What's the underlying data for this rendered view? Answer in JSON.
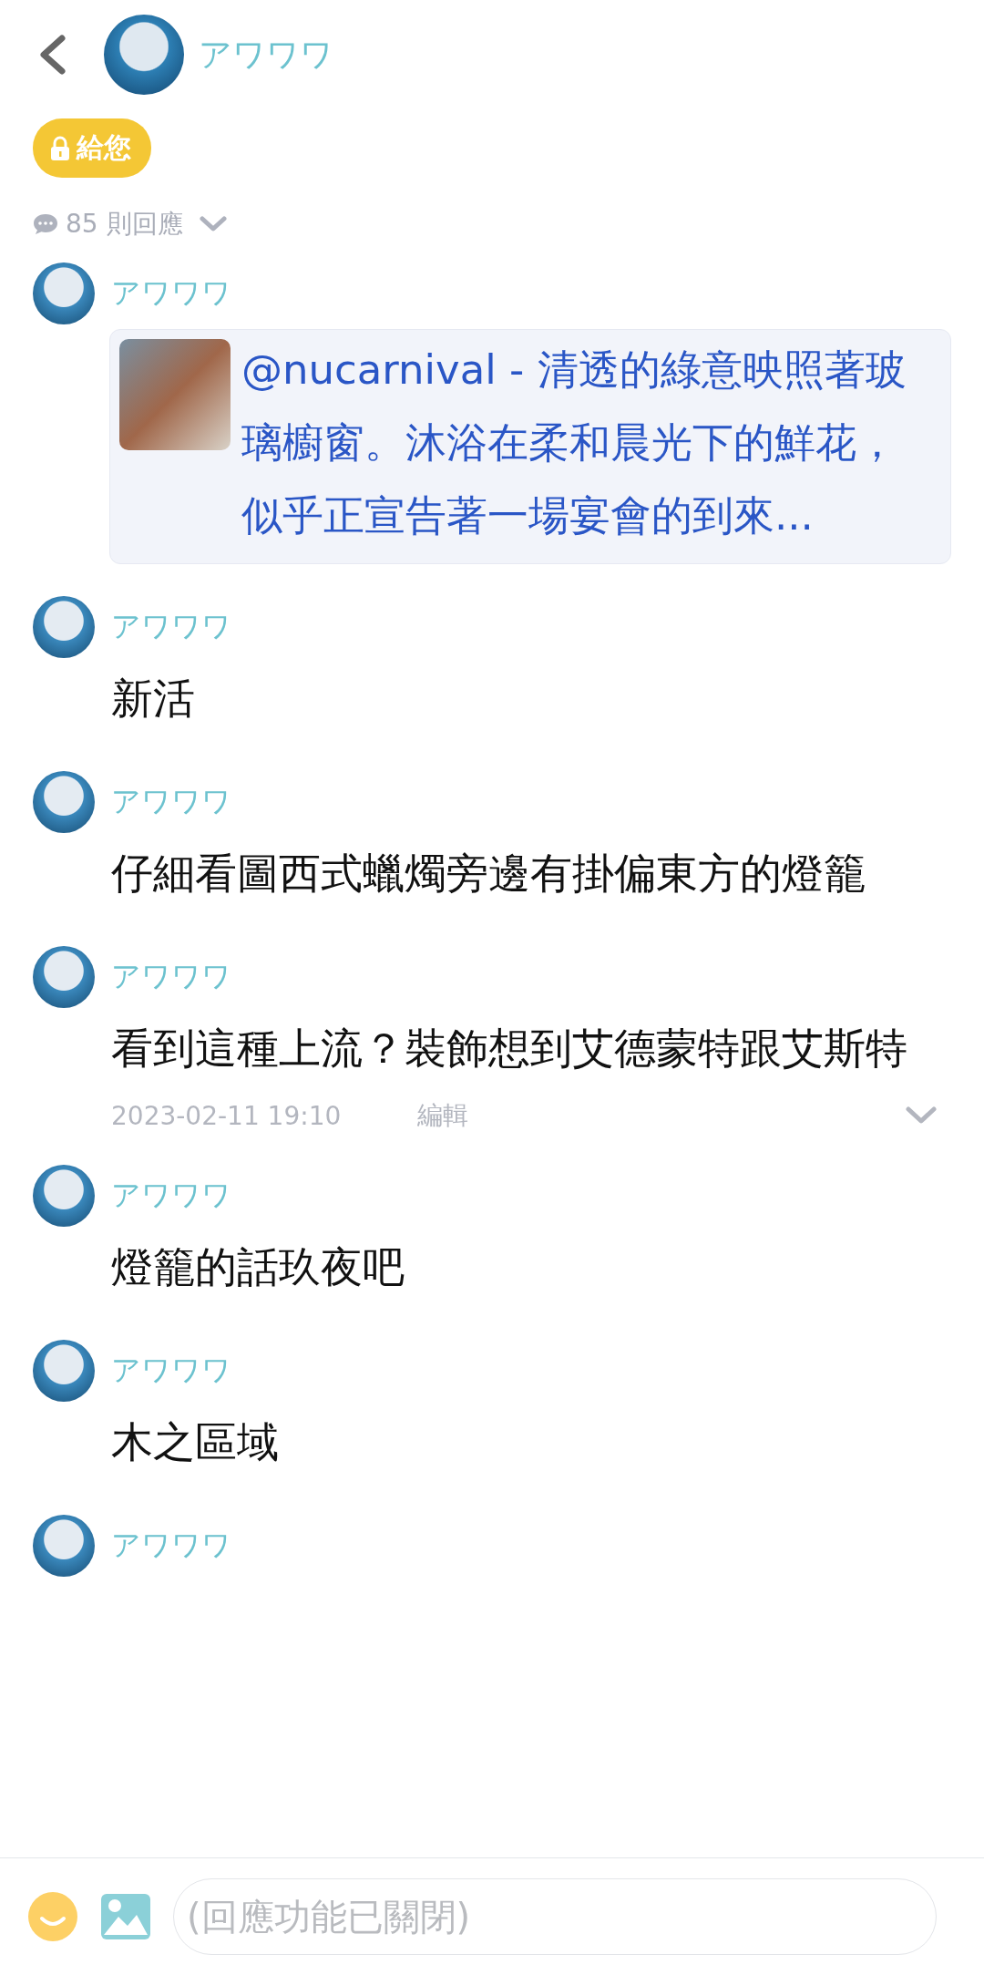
{
  "header": {
    "title": "アワワワ"
  },
  "badge": {
    "label": "給您"
  },
  "reply_count": "85 則回應",
  "comments": [
    {
      "author": "アワワワ",
      "quote": {
        "text": "@nucarnival - 清透的綠意映照著玻璃櫥窗。沐浴在柔和晨光下的鮮花，似乎正宣告著一場宴會的到來..."
      }
    },
    {
      "author": "アワワワ",
      "text": "新活"
    },
    {
      "author": "アワワワ",
      "text": "仔細看圖西式蠟燭旁邊有掛偏東方的燈籠"
    },
    {
      "author": "アワワワ",
      "text": "看到這種上流？裝飾想到艾德蒙特跟艾斯特",
      "time": "2023-02-11 19:10",
      "edit_label": "編輯"
    },
    {
      "author": "アワワワ",
      "text": "燈籠的話玖夜吧"
    },
    {
      "author": "アワワワ",
      "text": "木之區域"
    },
    {
      "author": "アワワワ"
    }
  ],
  "reply_bar": {
    "placeholder": "(回應功能已關閉)"
  }
}
